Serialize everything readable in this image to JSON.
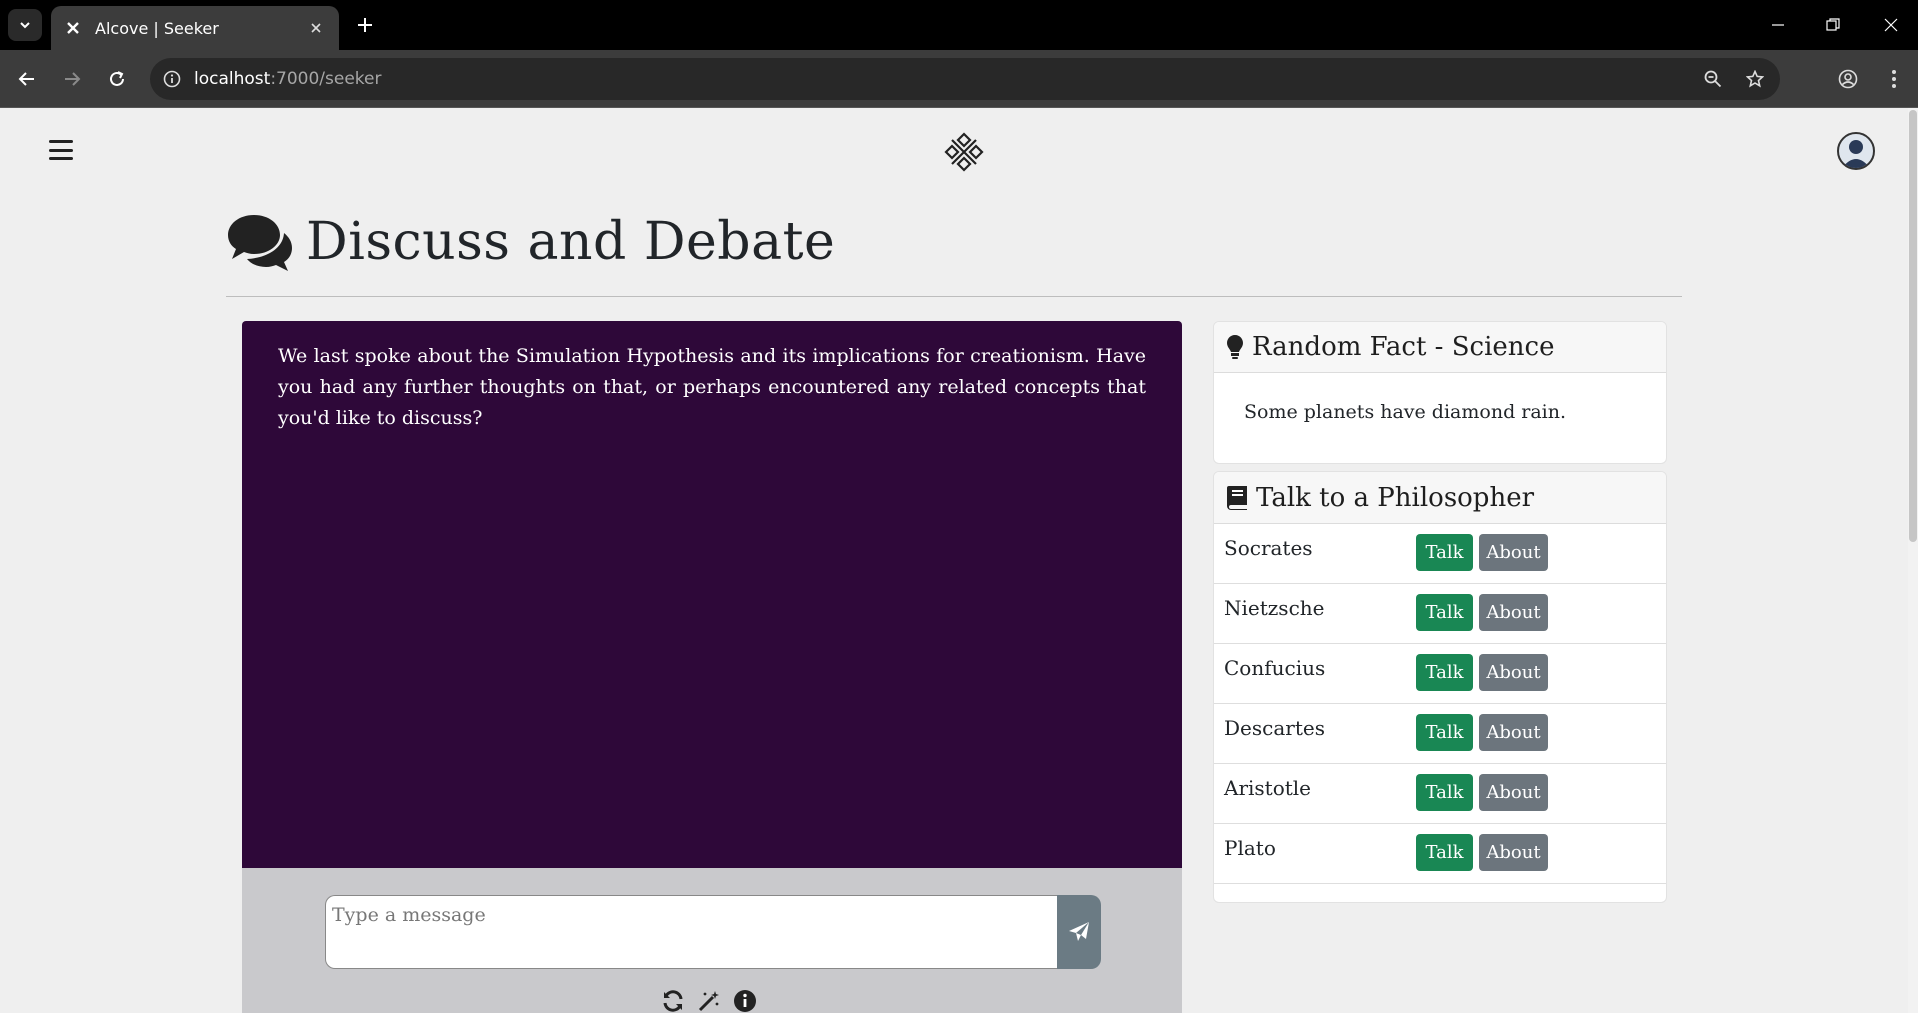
{
  "browser": {
    "tab_title": "Alcove | Seeker",
    "url_host": "localhost",
    "url_path": ":7000/seeker"
  },
  "page": {
    "title": "Discuss and Debate"
  },
  "chat": {
    "message": "We last spoke about the Simulation Hypothesis and its implications for creationism. Have you had any further thoughts on that, or perhaps encountered any related concepts that you'd like to discuss?",
    "input_placeholder": "Type a message"
  },
  "fact_card": {
    "title": "Random Fact - Science",
    "fact": "Some planets have diamond rain."
  },
  "philosopher_card": {
    "title": "Talk to a Philosopher",
    "talk_label": "Talk",
    "about_label": "About",
    "philosophers": [
      "Socrates",
      "Nietzsche",
      "Confucius",
      "Descartes",
      "Aristotle",
      "Plato"
    ]
  },
  "colors": {
    "chat_bg": "#2e0839",
    "talk_button": "#198754",
    "about_button": "#6c757d"
  }
}
